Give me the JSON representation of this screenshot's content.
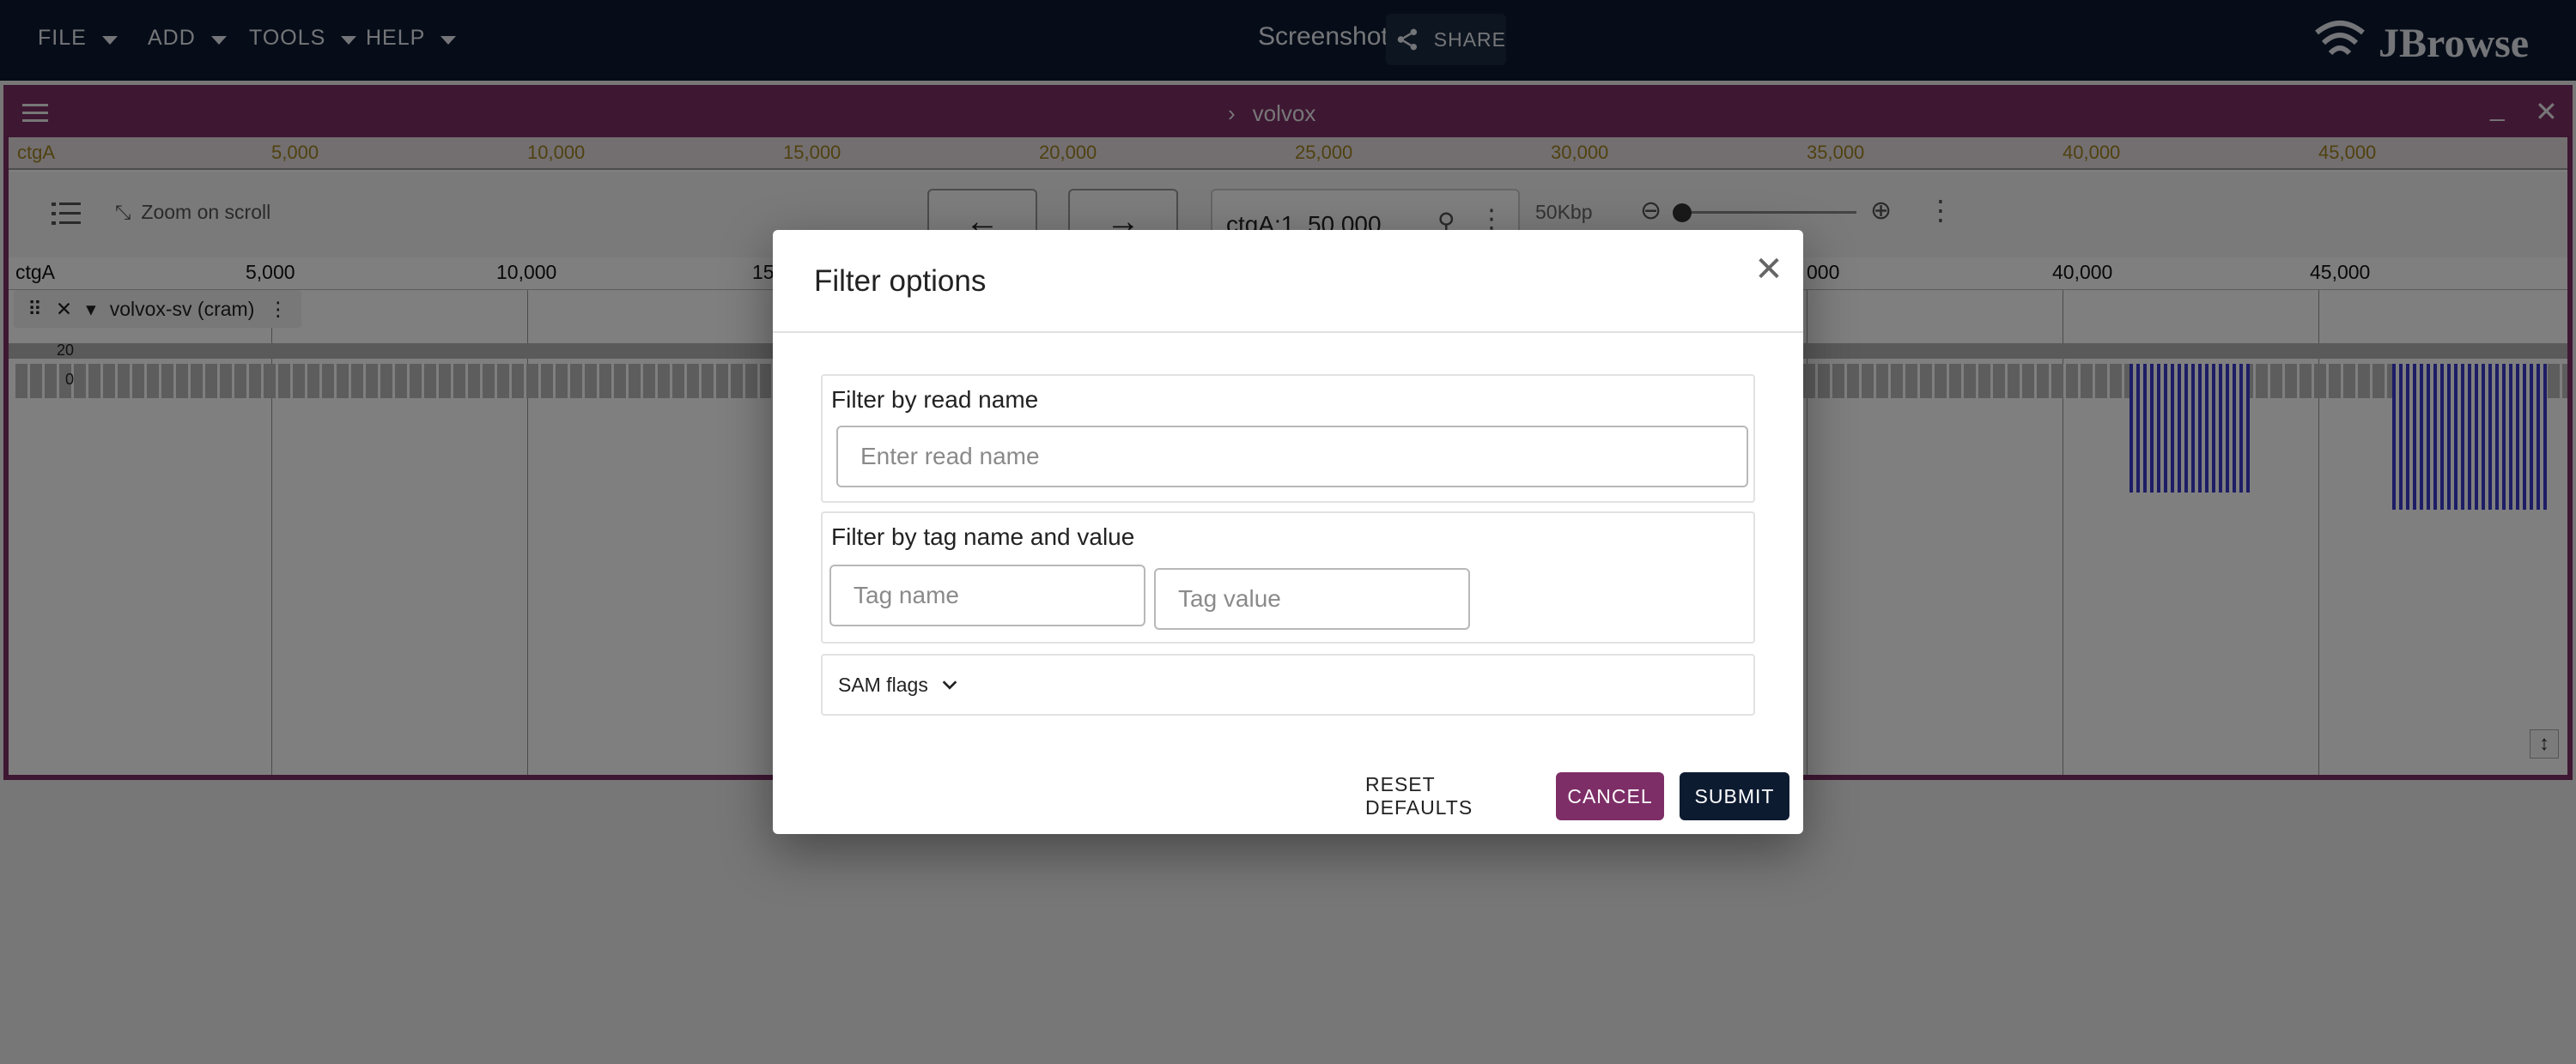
{
  "menu": [
    {
      "id": "file",
      "label": "FILE"
    },
    {
      "id": "add",
      "label": "ADD"
    },
    {
      "id": "tools",
      "label": "TOOLS"
    },
    {
      "id": "help",
      "label": "HELP"
    }
  ],
  "session": {
    "name": "Screenshot",
    "share_label": "SHARE"
  },
  "logo": {
    "text": "JBrowse"
  },
  "view": {
    "title": "volvox",
    "overview_ref": "ctgA",
    "overview_ticks": [
      "5,000",
      "10,000",
      "15,000",
      "20,000",
      "25,000",
      "30,000",
      "35,000",
      "40,000",
      "45,000"
    ],
    "zoom_on_scroll": "Zoom on scroll",
    "locstring": "ctgA:1..50,000",
    "scale": "50Kbp",
    "ruler_ref": "ctgA",
    "ruler_ticks_left": [
      "5,000",
      "10,000",
      "15,"
    ],
    "ruler_ticks_right": [
      "000",
      "40,000",
      "45,000"
    ],
    "track": {
      "name": "volvox-sv (cram)",
      "ymax": "20",
      "ymin": "0"
    }
  },
  "colors": {
    "appbar": "#0d1b31",
    "primary": "#7d2e67",
    "secondary": "#0d1b31"
  },
  "dialog": {
    "title": "Filter options",
    "read_name": {
      "label": "Filter by read name",
      "placeholder": "Enter read name"
    },
    "tag": {
      "label": "Filter by tag name and value",
      "name_placeholder": "Tag name",
      "value_placeholder": "Tag value"
    },
    "sam_flags": "SAM flags",
    "reset": "RESET DEFAULTS",
    "cancel": "CANCEL",
    "submit": "SUBMIT"
  }
}
